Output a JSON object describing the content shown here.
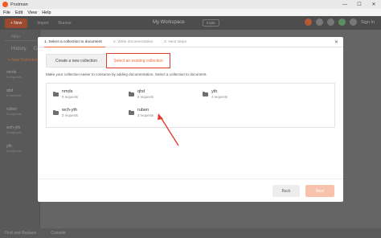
{
  "window": {
    "title": "Postman",
    "controls": [
      "—",
      "☐",
      "✕"
    ]
  },
  "menu": [
    "File",
    "Edit",
    "View",
    "Help"
  ],
  "toolbar": {
    "new_label": "+ New",
    "import_label": "Import",
    "runner_label": "Runner",
    "workspace_label": "My Workspace",
    "invite_label": "Invite",
    "signin_label": "Sign In"
  },
  "sidebar": {
    "filter_placeholder": "Filter",
    "tabs": [
      "History",
      "Co"
    ],
    "new_collection": "+ New Collection",
    "items": [
      {
        "name": "nmds",
        "sub": "9 requests"
      },
      {
        "name": "qhd",
        "sub": "6 requests"
      },
      {
        "name": "ruben",
        "sub": "3 requests"
      },
      {
        "name": "wch-yth",
        "sub": "3 requests"
      },
      {
        "name": "yth",
        "sub": "4 requests"
      }
    ]
  },
  "statusbar": {
    "find_replace": "Find and Replace",
    "console": "Console"
  },
  "modal": {
    "steps": [
      "1. Select a collection to document",
      "2. Write documentation",
      "3. Next steps"
    ],
    "close": "✕",
    "tab_create": "Create a new collection",
    "tab_existing": "Select an existing collection",
    "helptext": "Make your collection easier to consume by adding documentation. Select a collection to document.",
    "collections": [
      {
        "name": "nmds",
        "req": "9 requests"
      },
      {
        "name": "qhd",
        "req": "6 requests"
      },
      {
        "name": "yth",
        "req": "4 requests"
      },
      {
        "name": "wch-yth",
        "req": "3 requests"
      },
      {
        "name": "ruben",
        "req": "3 requests"
      }
    ],
    "back_label": "Back",
    "next_label": "Next"
  },
  "colors": {
    "accent": "#f26b3a",
    "highlight": "#e53b2f"
  }
}
